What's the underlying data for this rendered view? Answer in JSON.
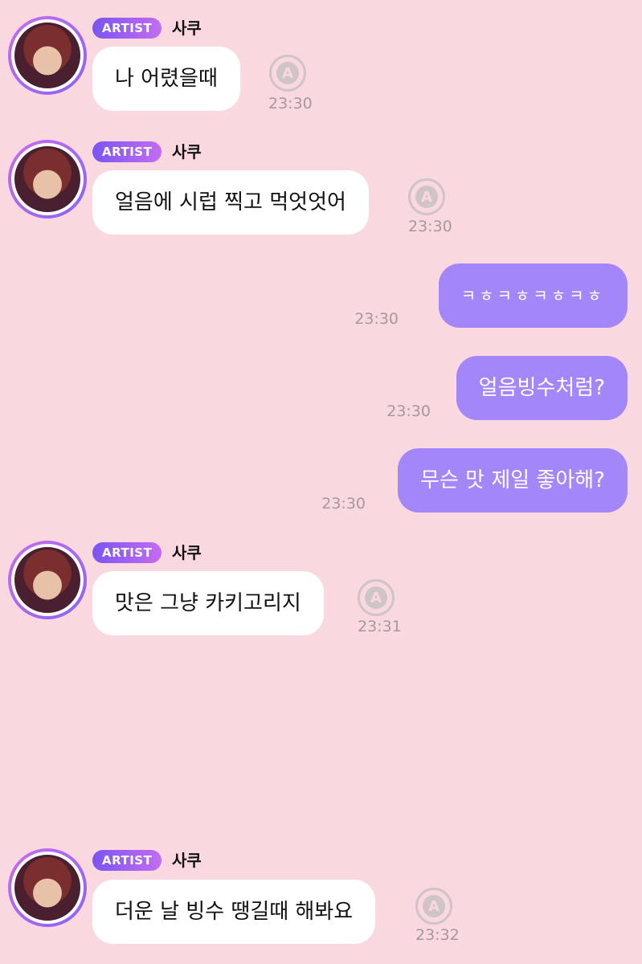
{
  "artist_badge": "ARTIST",
  "sender_name": "사쿠",
  "translate_glyph": "A",
  "messages": [
    {
      "direction": "in",
      "text": "나 어렸을때",
      "time": "23:30"
    },
    {
      "direction": "in",
      "text": "얼음에 시럽 찍고 먹엇엇어",
      "time": "23:30"
    },
    {
      "direction": "out",
      "text": "ㅋㅎㅋㅎㅋㅎㅋㅎ",
      "time": "23:30"
    },
    {
      "direction": "out",
      "text": "얼음빙수처럼?",
      "time": "23:30"
    },
    {
      "direction": "out",
      "text": "무슨 맛 제일 좋아해?",
      "time": "23:30"
    },
    {
      "direction": "in",
      "text": "맛은 그냥 카키고리지",
      "time": "23:31"
    },
    {
      "direction": "in",
      "text": "더운 날 빙수 땡길때 해봐요",
      "time": "23:32"
    }
  ],
  "colors": {
    "background": "#f9d9df",
    "incoming_bubble": "#ffffff",
    "outgoing_bubble": "#a386f7",
    "badge_start": "#7a55f2",
    "badge_end": "#c46cf0"
  }
}
